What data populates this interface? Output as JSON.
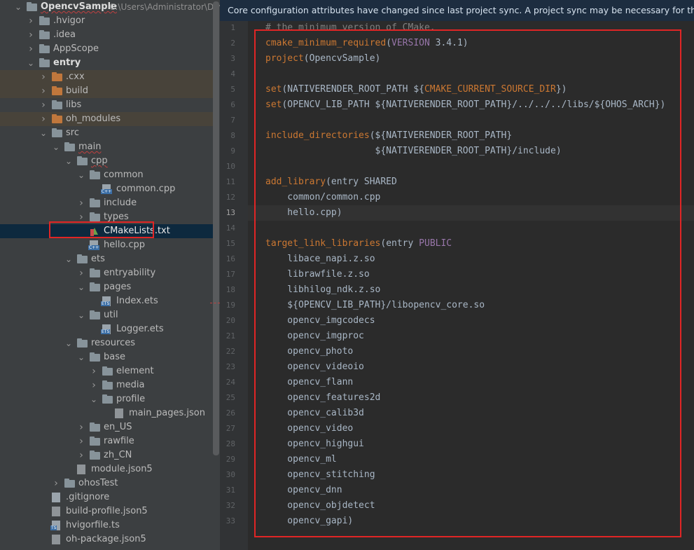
{
  "project": {
    "name": "OpencvSample",
    "path": "C:\\Users\\Administrator\\DevEco"
  },
  "tree": [
    {
      "label": "OpencvSample",
      "icon": "folder-icon",
      "depth": 0,
      "open": true,
      "bold": true,
      "wavy": true,
      "path": "C:\\Users\\Administrator\\DevEco"
    },
    {
      "label": ".hvigor",
      "icon": "folder-icon",
      "depth": 1,
      "open": false
    },
    {
      "label": ".idea",
      "icon": "folder-icon",
      "depth": 1,
      "open": false
    },
    {
      "label": "AppScope",
      "icon": "folder-icon",
      "depth": 1,
      "open": false
    },
    {
      "label": "entry",
      "icon": "folder-icon",
      "depth": 1,
      "open": true,
      "bold": true
    },
    {
      "label": ".cxx",
      "icon": "folder-orange-icon",
      "depth": 2,
      "open": false,
      "highlight": "yellow"
    },
    {
      "label": "build",
      "icon": "folder-orange-icon",
      "depth": 2,
      "open": false,
      "highlight": "yellow"
    },
    {
      "label": "libs",
      "icon": "folder-icon",
      "depth": 2,
      "open": false
    },
    {
      "label": "oh_modules",
      "icon": "folder-orange-icon",
      "depth": 2,
      "open": false,
      "highlight": "yellow"
    },
    {
      "label": "src",
      "icon": "folder-icon",
      "depth": 2,
      "open": true
    },
    {
      "label": "main",
      "icon": "folder-icon",
      "depth": 3,
      "open": true,
      "wavy": true
    },
    {
      "label": "cpp",
      "icon": "folder-icon",
      "depth": 4,
      "open": true,
      "wavy": true
    },
    {
      "label": "common",
      "icon": "folder-icon",
      "depth": 5,
      "open": true
    },
    {
      "label": "common.cpp",
      "icon": "cpp-file-icon",
      "depth": 6,
      "tag": "C++"
    },
    {
      "label": "include",
      "icon": "folder-icon",
      "depth": 5,
      "open": false
    },
    {
      "label": "types",
      "icon": "folder-icon",
      "depth": 5,
      "open": false
    },
    {
      "label": "CMakeLists.txt",
      "icon": "cmake-file-icon",
      "depth": 5,
      "selected": true,
      "highlight": "blue"
    },
    {
      "label": "hello.cpp",
      "icon": "cpp-file-icon",
      "depth": 5,
      "tag": "C++"
    },
    {
      "label": "ets",
      "icon": "folder-icon",
      "depth": 4,
      "open": true
    },
    {
      "label": "entryability",
      "icon": "folder-icon",
      "depth": 5,
      "open": false
    },
    {
      "label": "pages",
      "icon": "folder-icon",
      "depth": 5,
      "open": true
    },
    {
      "label": "Index.ets",
      "icon": "ets-file-icon",
      "depth": 6,
      "tag": "ETS"
    },
    {
      "label": "util",
      "icon": "folder-icon",
      "depth": 5,
      "open": true
    },
    {
      "label": "Logger.ets",
      "icon": "ets-file-icon",
      "depth": 6,
      "tag": "ETS"
    },
    {
      "label": "resources",
      "icon": "folder-icon",
      "depth": 4,
      "open": true
    },
    {
      "label": "base",
      "icon": "folder-icon",
      "depth": 5,
      "open": true
    },
    {
      "label": "element",
      "icon": "folder-icon",
      "depth": 6,
      "open": false
    },
    {
      "label": "media",
      "icon": "folder-icon",
      "depth": 6,
      "open": false
    },
    {
      "label": "profile",
      "icon": "folder-icon",
      "depth": 6,
      "open": true
    },
    {
      "label": "main_pages.json",
      "icon": "json-file-icon",
      "depth": 7
    },
    {
      "label": "en_US",
      "icon": "folder-icon",
      "depth": 5,
      "open": false
    },
    {
      "label": "rawfile",
      "icon": "folder-icon",
      "depth": 5,
      "open": false
    },
    {
      "label": "zh_CN",
      "icon": "folder-icon",
      "depth": 5,
      "open": false
    },
    {
      "label": "module.json5",
      "icon": "json-file-icon",
      "depth": 4
    },
    {
      "label": "ohosTest",
      "icon": "folder-icon",
      "depth": 3,
      "open": false
    },
    {
      "label": ".gitignore",
      "icon": "text-file-icon",
      "depth": 2
    },
    {
      "label": "build-profile.json5",
      "icon": "json-file-icon",
      "depth": 2
    },
    {
      "label": "hvigorfile.ts",
      "icon": "ts-file-icon",
      "depth": 2,
      "tag": "TS"
    },
    {
      "label": "oh-package.json5",
      "icon": "json-file-icon",
      "depth": 2
    }
  ],
  "editor": {
    "notice": "Core configuration attributes have changed since last project sync. A project sync may be necessary for the IDE to",
    "current_line": 13,
    "lines": [
      [
        {
          "t": "# the minimum version of CMake.",
          "c": "com"
        }
      ],
      [
        {
          "t": "cmake_minimum_required",
          "c": "cmd"
        },
        {
          "t": "("
        },
        {
          "t": "VERSION",
          "c": "kw"
        },
        {
          "t": " 3.4.1)"
        }
      ],
      [
        {
          "t": "project",
          "c": "cmd"
        },
        {
          "t": "(OpencvSample)"
        }
      ],
      [],
      [
        {
          "t": "set",
          "c": "cmd"
        },
        {
          "t": "(NATIVERENDER_ROOT_PATH ${"
        },
        {
          "t": "CMAKE_CURRENT_SOURCE_DIR",
          "c": "var"
        },
        {
          "t": "})"
        }
      ],
      [
        {
          "t": "set",
          "c": "cmd"
        },
        {
          "t": "(OPENCV_LIB_PATH ${NATIVERENDER_ROOT_PATH}/../../../libs/${OHOS_ARCH})"
        }
      ],
      [],
      [
        {
          "t": "include_directories",
          "c": "cmd"
        },
        {
          "t": "(${NATIVERENDER_ROOT_PATH}"
        }
      ],
      [
        {
          "t": "                    ${NATIVERENDER_ROOT_PATH}/include)"
        }
      ],
      [],
      [
        {
          "t": "add_library",
          "c": "cmd"
        },
        {
          "t": "(entry SHARED"
        }
      ],
      [
        {
          "t": "    common/common.cpp"
        }
      ],
      [
        {
          "t": "    hello.cpp)"
        }
      ],
      [],
      [
        {
          "t": "target_link_libraries",
          "c": "cmd"
        },
        {
          "t": "(entry "
        },
        {
          "t": "PUBLIC",
          "c": "kw"
        }
      ],
      [
        {
          "t": "    libace_napi.z.so"
        }
      ],
      [
        {
          "t": "    librawfile.z.so"
        }
      ],
      [
        {
          "t": "    libhilog_ndk.z.so"
        }
      ],
      [
        {
          "t": "    ${OPENCV_LIB_PATH}/libopencv_core.so"
        }
      ],
      [
        {
          "t": "    opencv_imgcodecs"
        }
      ],
      [
        {
          "t": "    opencv_imgproc"
        }
      ],
      [
        {
          "t": "    opencv_photo"
        }
      ],
      [
        {
          "t": "    opencv_videoio"
        }
      ],
      [
        {
          "t": "    opencv_flann"
        }
      ],
      [
        {
          "t": "    opencv_features2d"
        }
      ],
      [
        {
          "t": "    opencv_calib3d"
        }
      ],
      [
        {
          "t": "    opencv_video"
        }
      ],
      [
        {
          "t": "    opencv_highgui"
        }
      ],
      [
        {
          "t": "    opencv_ml"
        }
      ],
      [
        {
          "t": "    opencv_stitching"
        }
      ],
      [
        {
          "t": "    opencv_dnn"
        }
      ],
      [
        {
          "t": "    opencv_objdetect"
        }
      ],
      [
        {
          "t": "    opencv_gapi)"
        }
      ]
    ]
  },
  "colors": {
    "highlight_box": "#e02525",
    "keyword": "#cc7832",
    "constant": "#9876aa",
    "comment": "#808080",
    "text": "#a9b7c6"
  }
}
